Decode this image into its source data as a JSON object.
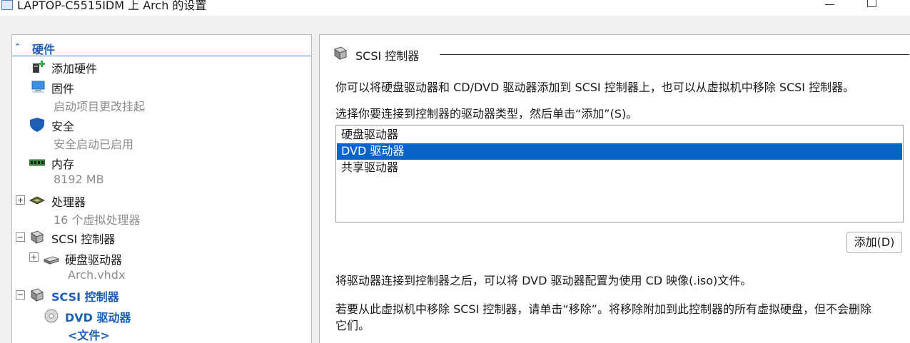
{
  "window": {
    "title": "LAPTOP-C5515IDM 上 Arch 的设置"
  },
  "sidebar": {
    "section_title": "硬件",
    "items": [
      {
        "label": "添加硬件"
      },
      {
        "label": "固件",
        "sub": "启动项目更改挂起"
      },
      {
        "label": "安全",
        "sub": "安全启动已启用"
      },
      {
        "label": "内存",
        "sub": "8192 MB"
      },
      {
        "label": "处理器",
        "sub": "16 个虚拟处理器"
      },
      {
        "label": "SCSI 控制器"
      },
      {
        "label": "硬盘驱动器",
        "sub": "Arch.vhdx"
      },
      {
        "label": "SCSI 控制器"
      },
      {
        "label": "DVD 驱动器",
        "sub": "<文件>"
      }
    ]
  },
  "main": {
    "group_title": "SCSI 控制器",
    "intro": "你可以将硬盘驱动器和 CD/DVD 驱动器添加到 SCSI 控制器上，也可以从虚拟机中移除 SCSI 控制器。",
    "instruction": "选择你要连接到控制器的驱动器类型，然后单击“添加”(S)。",
    "drive_types": [
      "硬盘驱动器",
      "DVD 驱动器",
      "共享驱动器"
    ],
    "selected_drive_type": "DVD 驱动器",
    "add_button": "添加(D)",
    "note_after": "将驱动器连接到控制器之后，可以将 DVD 驱动器配置为使用 CD 映像(.iso)文件。",
    "remove_note_line1": "若要从此虚拟机中移除 SCSI 控制器，请单击“移除”。将移除附加到此控制器的所有虚拟硬盘，但不会删除",
    "remove_note_line2": "它们。"
  },
  "colors": {
    "accent": "#1e5fb4",
    "selection": "#0a64c8",
    "muted_text": "#8c8c8c"
  }
}
